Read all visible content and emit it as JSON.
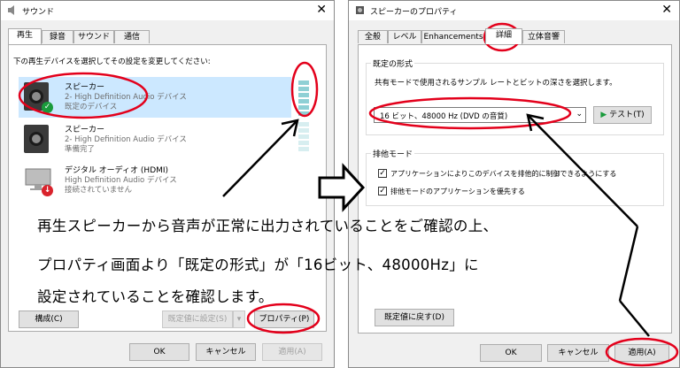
{
  "sound_dialog": {
    "title": "サウンド",
    "tabs": [
      "再生",
      "録音",
      "サウンド",
      "通信"
    ],
    "instruction": "下の再生デバイスを選択してその設定を変更してください:",
    "devices": [
      {
        "name": "スピーカー",
        "line2": "2- High Definition Audio デバイス",
        "line3": "既定のデバイス",
        "icon": "speaker-icon"
      },
      {
        "name": "スピーカー",
        "line2": "2- High Definition Audio デバイス",
        "line3": "準備完了",
        "icon": "speaker-icon"
      },
      {
        "name": "デジタル オーディオ (HDMI)",
        "line2": "High Definition Audio デバイス",
        "line3": "接続されていません",
        "icon": "monitor-icon"
      }
    ],
    "configure_button": "構成(C)",
    "set_default_button": "既定値に設定(S)",
    "properties_button": "プロパティ(P)",
    "ok_button": "OK",
    "cancel_button": "キャンセル",
    "apply_button": "適用(A)"
  },
  "properties_dialog": {
    "title": "スピーカーのプロパティ",
    "tabs": [
      "全般",
      "レベル",
      "Enhancements",
      "詳細",
      "立体音響"
    ],
    "default_format_group": "既定の形式",
    "default_format_desc": "共有モードで使用されるサンプル レートとビットの深さを選択します。",
    "format_value": "16 ビット、48000 Hz (DVD の音質)",
    "test_button": "テスト(T)",
    "exclusive_group": "排他モード",
    "checkbox1": "アプリケーションによりこのデバイスを排他的に制御できるようにする",
    "checkbox2": "排他モードのアプリケーションを優先する",
    "restore_defaults_button": "既定値に戻す(D)",
    "ok_button": "OK",
    "cancel_button": "キャンセル",
    "apply_button": "適用(A)"
  },
  "annotation": {
    "line1": "再生スピーカーから音声が正常に出力されていることをご確認の上、",
    "line2": "プロパティ画面より「既定の形式」が「16ビット、48000Hz」に",
    "line3": "設定されていることを確認します。"
  },
  "colors": {
    "highlight_red": "#e3001b",
    "selection_blue": "#cce8ff",
    "check_green": "#1a9b3c",
    "unplugged_red": "#d9232c",
    "level_meter": "#8fd0d5"
  }
}
